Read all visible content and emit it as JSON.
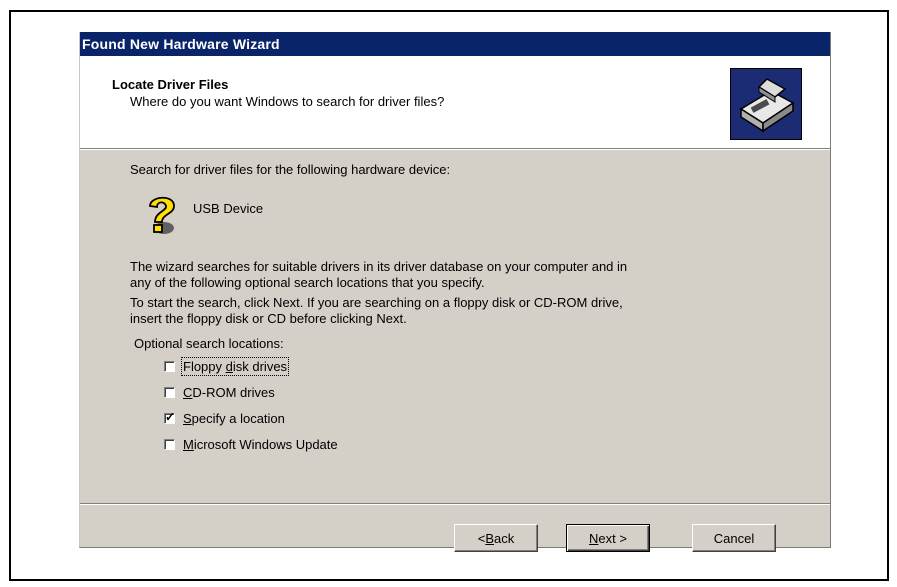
{
  "window": {
    "title": "Found New Hardware Wizard"
  },
  "header": {
    "title": "Locate Driver Files",
    "subtitle": "Where do you want Windows to search for driver files?",
    "icon": "hardware-wizard-icon"
  },
  "content": {
    "intro": "Search for driver files for the following hardware device:",
    "device_name": "USB Device",
    "device_icon": "unknown-device-question-icon",
    "para1_line1": "The wizard searches for suitable drivers in its driver database on your computer and in",
    "para1_line2": "any of the following optional search locations that you specify.",
    "para2_line1": "To start the search, click Next. If you are searching on a floppy disk or CD-ROM drive,",
    "para2_line2": "insert the floppy disk or CD before clicking Next.",
    "options_heading": "Optional search locations:",
    "options": [
      {
        "pre": "Floppy ",
        "key": "d",
        "post": "isk drives",
        "checked": false
      },
      {
        "pre": "",
        "key": "C",
        "post": "D-ROM drives",
        "checked": false
      },
      {
        "pre": "",
        "key": "S",
        "post": "pecify a location",
        "checked": true
      },
      {
        "pre": "",
        "key": "M",
        "post": "icrosoft Windows Update",
        "checked": false
      }
    ]
  },
  "buttons": {
    "back": {
      "pre": "< ",
      "key": "B",
      "post": "ack"
    },
    "next": {
      "pre": "",
      "key": "N",
      "post": "ext >"
    },
    "cancel": "Cancel"
  }
}
